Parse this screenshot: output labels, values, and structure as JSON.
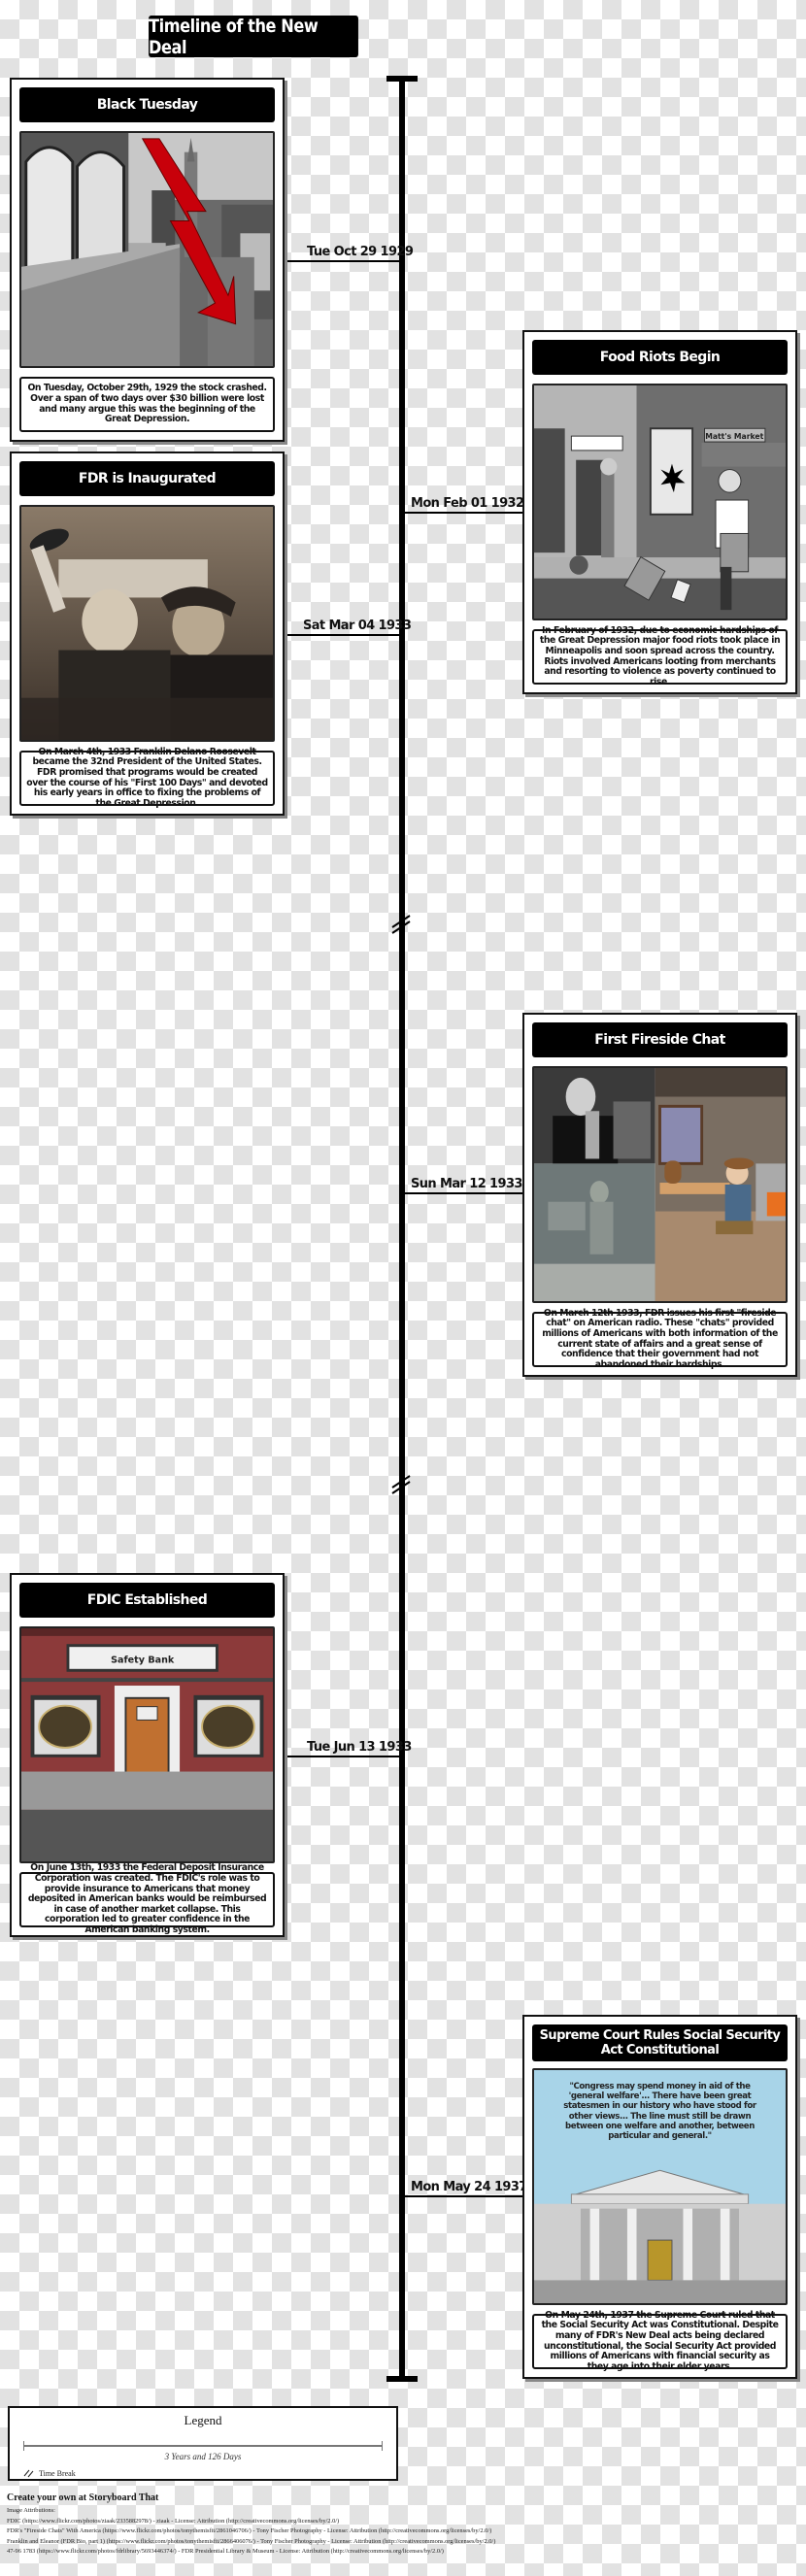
{
  "title": "Timeline of the New Deal",
  "events": [
    {
      "date": "Tue Oct 29 1929",
      "title": "Black Tuesday",
      "description": "On Tuesday, October 29th, 1929 the stock crashed. Over a span of two days over $30 billion were lost and many argue this was the beginning of the Great Depression.",
      "image": "stock-crash-skyline-illustration",
      "side": "left"
    },
    {
      "date": "Mon Feb 01 1932",
      "title": "Food Riots Begin",
      "description": "In February of 1932, due to economic hardships of the Great Depression major food riots took place in Minneapolis and soon spread across the country. Riots involved Americans looting from merchants and resorting to violence as poverty continued to rise.",
      "image": "street-riot-illustration",
      "image_sign": "Matt's Market",
      "side": "right"
    },
    {
      "date": "Sat Mar 04 1933",
      "title": "FDR is Inaugurated",
      "description": "On March 4th, 1933 Franklin Delano Roosevelt became the 32nd President of the United States. FDR promised that programs would be created over the course of his \"First 100 Days\" and devoted his early years in office to fixing the problems of the Great Depression.",
      "image": "fdr-inauguration-photo",
      "side": "left"
    },
    {
      "date": "Sun Mar 12 1933",
      "title": "First Fireside Chat",
      "description": "On March 12th 1933, FDR issues his first \"fireside chat\" on American radio. These \"chats\" provided millions of Americans with both information of the current state of affairs and a great sense of confidence that their government had not abandoned their hardships.",
      "image": "fireside-chat-collage",
      "side": "right"
    },
    {
      "date": "Tue Jun 13 1933",
      "title": "FDIC Established",
      "description": "On June 13th, 1933 the Federal Deposit Insurance Corporation was created. The FDIC's role was to provide insurance to Americans that money deposited in American banks would be reimbursed in case of another market collapse. This corporation led to greater confidence in the American banking system.",
      "image": "safety-bank-illustration",
      "image_sign": "Safety Bank",
      "side": "left"
    },
    {
      "date": "Mon May 24 1937",
      "title": "Supreme Court Rules Social Security Act Constitutional",
      "description": "On May 24th, 1937 the Supreme Court ruled that the Social Security Act was Constitutional. Despite many of FDR's New Deal acts being declared unconstitutional, the Social Security Act provided millions of Americans with financial security as they age into their elder years.",
      "image": "supreme-court-building-illustration",
      "image_quote": "\"Congress may spend money in aid of the 'general welfare'... There have been great statesmen in our history who have stood for other views... The line must still be drawn between one welfare and another, between particular and general.\"",
      "side": "right"
    }
  ],
  "time_breaks": 2,
  "legend": {
    "title": "Legend",
    "span": "3 Years and 126 Days",
    "break_icon": "double-slash",
    "break_label": "Time Break"
  },
  "footer": {
    "cta": "Create your own at Storyboard That",
    "attributions_label": "Image Attributions:",
    "attributions": [
      "FDIC (https://www.flickr.com/photos/ziaak/2335882978/) - ziaak - License: Attribution (http://creativecommons.org/licenses/by/2.0/)",
      "FDR's \"Fireside Chats\" With America (https://www.flickr.com/photos/tonythemisfit/2861046706/) - Tony Fischer Photography - License: Attribution (http://creativecommons.org/licenses/by/2.0/)",
      "Franklin and Eleanor (FDR Bio, part 1) (https://www.flickr.com/photos/tonythemisfit/2866406076/) - Tony Fischer Photography - License: Attribution (http://creativecommons.org/licenses/by/2.0/)",
      "47-96 1783 (https://www.flickr.com/photos/fdrlibrary/5693446374/) - FDR Presidential Library & Museum - License: Attribution (http://creativecommons.org/licenses/by/2.0/)"
    ]
  },
  "colors": {
    "crash_arrow": "#c8000a",
    "bank_brick": "#8c3a3a",
    "bank_door": "#c07030",
    "court_sky": "#a8d4e8"
  }
}
